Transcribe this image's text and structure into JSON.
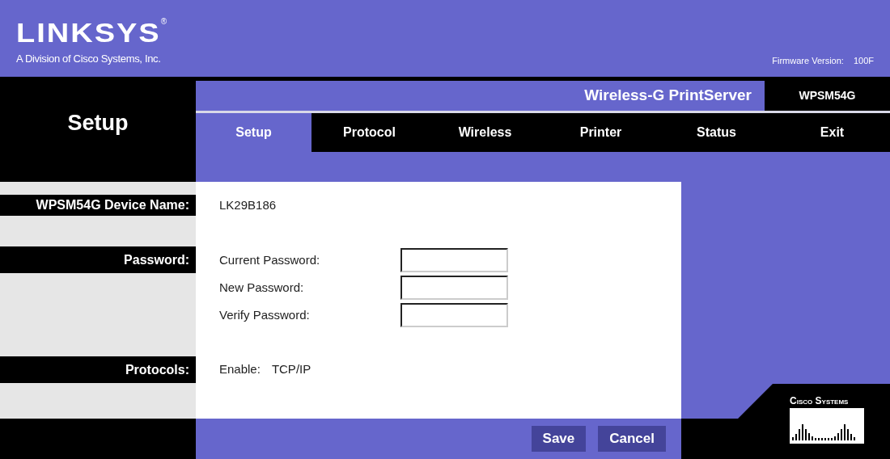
{
  "header": {
    "logo": "LINKSYS",
    "logo_mark": "®",
    "tagline": "A Division of Cisco Systems, Inc.",
    "firmware_label": "Firmware Version:",
    "firmware_value": "100F"
  },
  "section_title": "Setup",
  "product_name": "Wireless-G PrintServer",
  "model": "WPSM54G",
  "tabs": [
    {
      "label": "Setup",
      "selected": true
    },
    {
      "label": "Protocol",
      "selected": false
    },
    {
      "label": "Wireless",
      "selected": false
    },
    {
      "label": "Printer",
      "selected": false
    },
    {
      "label": "Status",
      "selected": false
    },
    {
      "label": "Exit",
      "selected": false
    }
  ],
  "form": {
    "device_name": {
      "label": "WPSM54G Device Name:",
      "value": "LK29B186"
    },
    "password": {
      "label": "Password:",
      "fields": [
        {
          "label": "Current Password:"
        },
        {
          "label": "New Password:"
        },
        {
          "label": "Verify Password:"
        }
      ]
    },
    "protocols": {
      "label": "Protocols:",
      "prefix": "Enable:",
      "value": "TCP/IP"
    }
  },
  "buttons": [
    "Save",
    "Cancel"
  ],
  "brand": "Cisco Systems"
}
